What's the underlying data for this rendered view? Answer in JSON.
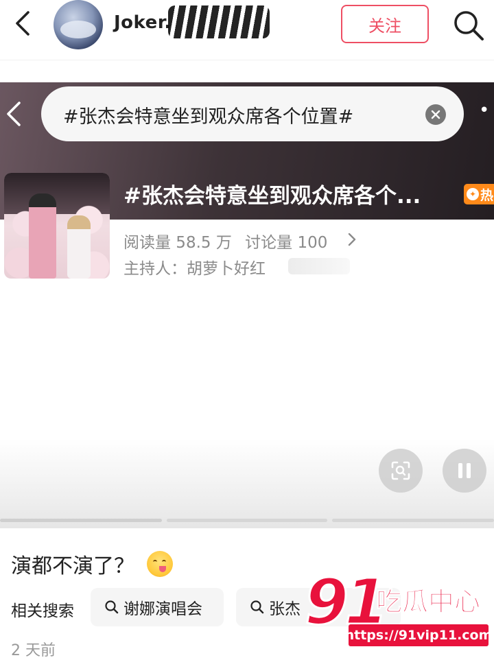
{
  "header": {
    "username": "Joker.",
    "follow_label": "关注"
  },
  "topic": {
    "search_query": "#张杰会特意坐到观众席各个位置#",
    "title": "#张杰会特意坐到观众席各个...",
    "hot_badge": "热",
    "reads": "阅读量 58.5 万",
    "discussions": "讨论量 100",
    "host": "主持人：胡萝卜好红"
  },
  "post": {
    "text": "演都不演了？",
    "time": "2 天前"
  },
  "related": {
    "label": "相关搜索",
    "chips": [
      {
        "label": "谢娜演唱会"
      },
      {
        "label": "张杰"
      }
    ]
  },
  "watermark": {
    "number": "91",
    "name": "吃瓜中心",
    "url": "https://91vip11.com"
  },
  "colors": {
    "accent": "#ee4e63",
    "hot": "#ff8a1a",
    "watermark": "#e8123c"
  }
}
